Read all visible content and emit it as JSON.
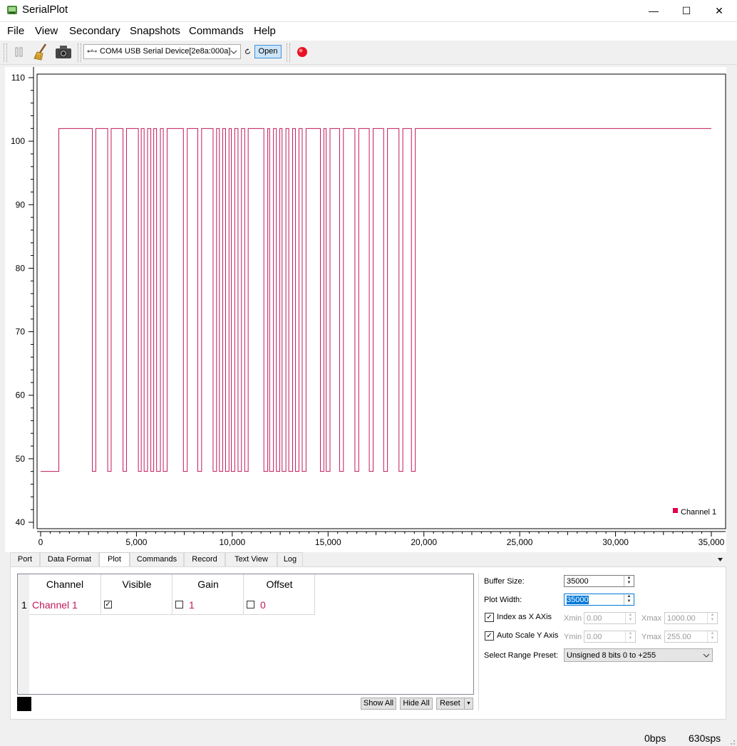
{
  "window": {
    "title": "SerialPlot",
    "minimize": "—",
    "maximize": "☐",
    "close": "✕"
  },
  "menu": [
    "File",
    "View",
    "Secondary",
    "Snapshots",
    "Commands",
    "Help"
  ],
  "toolbar": {
    "port_value": "COM4 USB Serial Device[2e8a:000a]",
    "open_label": "Open",
    "accent_record": "#e81123"
  },
  "plot": {
    "legend_label": "Channel 1"
  },
  "chart_data": {
    "type": "line",
    "series": [
      {
        "name": "Channel 1",
        "color": "#c2185b"
      }
    ],
    "x_ticks": [
      "0",
      "5,000",
      "10,000",
      "15,000",
      "20,000",
      "25,000",
      "30,000",
      "35,000"
    ],
    "y_ticks": [
      "40",
      "50",
      "60",
      "70",
      "80",
      "90",
      "100",
      "110"
    ],
    "xlim": [
      0,
      35000
    ],
    "ylim": [
      40,
      110
    ],
    "low": 48,
    "high": 102,
    "rise_x": 950,
    "settle_x": 19600,
    "end_x": 35000,
    "pulses": [
      [
        2700,
        2880
      ],
      [
        3500,
        3680
      ],
      [
        4300,
        4480
      ],
      [
        5100,
        5250
      ],
      [
        5400,
        5580
      ],
      [
        5750,
        5900
      ],
      [
        6050,
        6250
      ],
      [
        6400,
        6600
      ],
      [
        7450,
        7650
      ],
      [
        8200,
        8400
      ],
      [
        9000,
        9180
      ],
      [
        9330,
        9500
      ],
      [
        9650,
        9830
      ],
      [
        9950,
        10130
      ],
      [
        10300,
        10480
      ],
      [
        10650,
        10830
      ],
      [
        11650,
        11850
      ],
      [
        11950,
        12150
      ],
      [
        12300,
        12480
      ],
      [
        12600,
        12800
      ],
      [
        12950,
        13150
      ],
      [
        13300,
        13480
      ],
      [
        13650,
        13850
      ],
      [
        14600,
        14780
      ],
      [
        14900,
        15100
      ],
      [
        15600,
        15800
      ],
      [
        16400,
        16600
      ],
      [
        17150,
        17350
      ],
      [
        17900,
        18100
      ],
      [
        18700,
        18900
      ],
      [
        19350,
        19550
      ]
    ]
  },
  "tabs": [
    "Port",
    "Data Format",
    "Plot",
    "Commands",
    "Record",
    "Text View",
    "Log"
  ],
  "tabs_active": "Plot",
  "channel_table": {
    "headers": [
      "Channel",
      "Visible",
      "Gain",
      "Offset"
    ],
    "rows": [
      {
        "index": "1",
        "name": "Channel 1",
        "visible": true,
        "gain_enabled": false,
        "gain": "1",
        "offset_enabled": false,
        "offset": "0"
      }
    ],
    "color_swatch": "#000000",
    "buttons": {
      "show_all": "Show All",
      "hide_all": "Hide All",
      "reset": "Reset"
    }
  },
  "settings": {
    "buffer_size_label": "Buffer Size:",
    "buffer_size": "35000",
    "plot_width_label": "Plot Width:",
    "plot_width": "35000",
    "index_as_x_label": "Index as X AXis",
    "index_as_x": true,
    "xmin_label": "Xmin",
    "xmin": "0.00",
    "xmax_label": "Xmax",
    "xmax": "1000.00",
    "auto_scale_y_label": "Auto Scale Y Axis",
    "auto_scale_y": true,
    "ymin_label": "Ymin",
    "ymin": "0.00",
    "ymax_label": "Ymax",
    "ymax": "255.00",
    "range_preset_label": "Select Range Preset:",
    "range_preset": "Unsigned 8 bits 0 to +255"
  },
  "status": {
    "bps": "0bps",
    "sps": "630sps"
  }
}
